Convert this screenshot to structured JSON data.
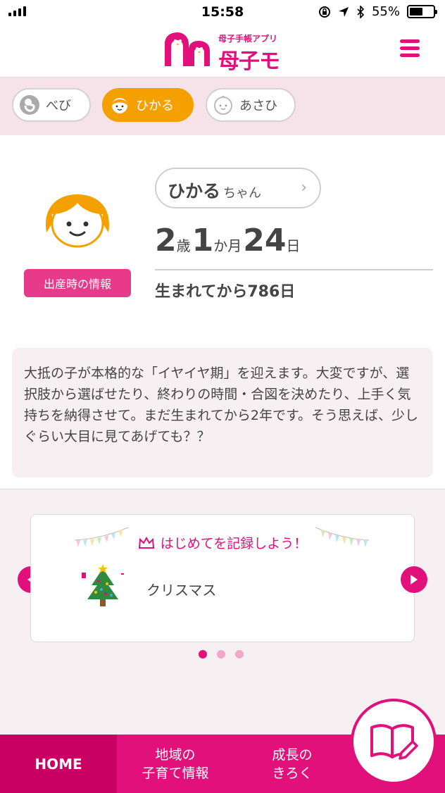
{
  "status_bar": {
    "time": "15:58",
    "battery": "55%"
  },
  "header": {
    "logo_sub": "母子手帳アプリ",
    "logo_main": "母子モ"
  },
  "children": [
    {
      "label": "べび",
      "active": false
    },
    {
      "label": "ひかる",
      "active": true
    },
    {
      "label": "あさひ",
      "active": false
    }
  ],
  "profile": {
    "name": "ひかる",
    "name_suffix": "ちゃん",
    "age_years": "2",
    "age_years_unit": "歳",
    "age_months": "1",
    "age_months_unit": "か月",
    "age_days": "24",
    "age_days_unit": "日",
    "days_since_birth": "生まれてから786日",
    "birth_info_button": "出産時の情報"
  },
  "message": "大抵の子が本格的な「イヤイヤ期」を迎えます。大変ですが、選択肢から選ばせたり、終わりの時間・合図を決めたり、上手く気持ちを納得させて。まだ生まれてから2年です。そう思えば、少しぐらい大目に見てあげても？？",
  "first_time": {
    "title": "はじめてを記録しよう！",
    "item_label": "クリスマス",
    "page_count": 3,
    "current_page": 1
  },
  "bottom_nav": {
    "home": "HOME",
    "area_line1": "地域の",
    "area_line2": "子育て情報",
    "growth_line1": "成長の",
    "growth_line2": "きろく"
  },
  "colors": {
    "brand": "#e2107a",
    "active_child": "#f4a000",
    "birth_button": "#e83a8a"
  }
}
